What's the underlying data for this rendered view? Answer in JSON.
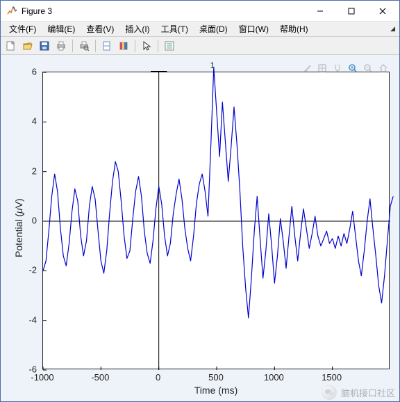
{
  "window": {
    "title": "Figure 3",
    "controls": {
      "min": "–",
      "max": "☐",
      "close": "✕"
    }
  },
  "menu": {
    "items": [
      "文件(F)",
      "编辑(E)",
      "查看(V)",
      "插入(I)",
      "工具(T)",
      "桌面(D)",
      "窗口(W)",
      "帮助(H)"
    ]
  },
  "toolbar_icons": [
    "new-figure-icon",
    "open-icon",
    "save-icon",
    "print-icon",
    "sep",
    "print-preview-icon",
    "sep",
    "link-icon",
    "insert-colorbar-icon",
    "sep",
    "pointer-icon",
    "sep",
    "data-cursor-icon"
  ],
  "axes_toolbar": [
    "brush-icon",
    "pan-icon",
    "rotate-icon",
    "zoom-in-icon",
    "zoom-out-icon",
    "home-icon"
  ],
  "axes_toolbar_active": "zoom-in-icon",
  "annotation": {
    "label": "1"
  },
  "watermark": {
    "text": "脑机接口社区"
  },
  "chart_data": {
    "type": "line",
    "title": "",
    "xlabel": "Time (ms)",
    "ylabel": "Potential (μV)",
    "xlim": [
      -1000,
      2000
    ],
    "ylim": [
      -6,
      6
    ],
    "xticks": [
      -1000,
      -500,
      0,
      500,
      1000,
      1500
    ],
    "yticks": [
      -6,
      -4,
      -2,
      0,
      2,
      4,
      6
    ],
    "series": [
      {
        "name": "1",
        "color": "#0000cd",
        "x_step": 25,
        "x_start": -1000,
        "values": [
          -2.0,
          -1.6,
          -0.4,
          1.0,
          1.9,
          1.2,
          -0.3,
          -1.4,
          -1.8,
          -0.9,
          0.4,
          1.3,
          0.8,
          -0.6,
          -1.4,
          -0.8,
          0.6,
          1.4,
          0.9,
          -0.4,
          -1.6,
          -2.1,
          -1.2,
          0.3,
          1.6,
          2.4,
          2.0,
          0.8,
          -0.6,
          -1.5,
          -1.2,
          0.1,
          1.2,
          1.8,
          1.0,
          -0.4,
          -1.3,
          -1.7,
          -0.8,
          0.5,
          1.4,
          0.7,
          -0.6,
          -1.4,
          -0.9,
          0.3,
          1.1,
          1.7,
          0.9,
          -0.3,
          -1.1,
          -1.6,
          -0.6,
          0.7,
          1.5,
          1.9,
          1.2,
          0.2,
          3.1,
          6.2,
          4.4,
          2.6,
          4.8,
          3.2,
          1.6,
          3.0,
          4.6,
          3.1,
          1.3,
          -1.0,
          -2.7,
          -3.9,
          -2.3,
          -0.4,
          1.0,
          -0.7,
          -2.3,
          -1.2,
          0.3,
          -1.0,
          -2.5,
          -1.4,
          0.1,
          -0.8,
          -1.9,
          -0.6,
          0.6,
          -0.6,
          -1.6,
          -0.5,
          0.5,
          -0.3,
          -1.1,
          -0.5,
          0.2,
          -0.6,
          -1.0,
          -0.7,
          -0.4,
          -0.9,
          -0.7,
          -1.1,
          -0.6,
          -1.0,
          -0.5,
          -0.9,
          -0.3,
          0.4,
          -0.6,
          -1.6,
          -2.2,
          -1.2,
          0.0,
          0.9,
          -0.3,
          -1.4,
          -2.6,
          -3.3,
          -2.2,
          -0.8,
          0.6,
          1.0
        ]
      }
    ],
    "zero_lines": {
      "x0": 0,
      "y0": 0
    },
    "y0_marker": {
      "x": 0,
      "y_top": 6.2
    }
  }
}
